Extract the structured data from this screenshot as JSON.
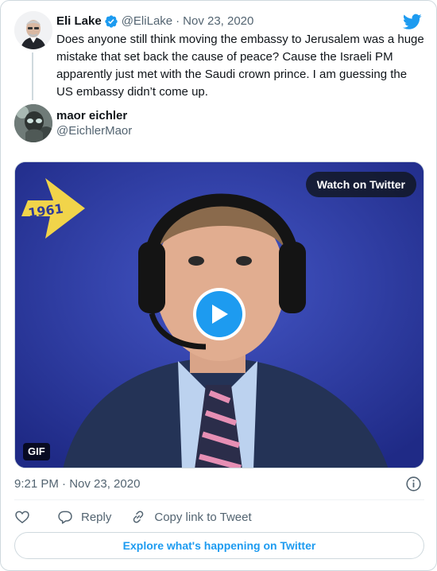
{
  "quoted_tweet": {
    "author_name": "Eli Lake",
    "handle": "@EliLake",
    "separator": "·",
    "date": "Nov 23, 2020",
    "text": "Does anyone still think moving the embassy to Jerusalem was a huge mistake that set back the cause of peace? Cause the Israeli PM apparently just met with the Saudi crown prince. I am guessing the US embassy didn’t come up."
  },
  "tweet": {
    "author_name": "maor eichler",
    "handle": "@EichlerMaor",
    "timestamp": "9:21 PM · Nov 23, 2020"
  },
  "media": {
    "watch_label": "Watch on Twitter",
    "gif_label": "GIF",
    "logo_text": "1961"
  },
  "actions": {
    "reply_label": "Reply",
    "copy_link_label": "Copy link to Tweet"
  },
  "explore_label": "Explore what's happening on Twitter",
  "icons": {
    "brand": "twitter-bird-icon",
    "verified": "verified-badge-icon",
    "play": "play-icon",
    "info": "info-icon",
    "like": "heart-icon",
    "reply": "reply-bubble-icon",
    "copy_link": "link-icon"
  },
  "colors": {
    "accent": "#1d9bf0",
    "text_primary": "#0f1419",
    "text_secondary": "#536471",
    "border": "#cfd9de"
  }
}
